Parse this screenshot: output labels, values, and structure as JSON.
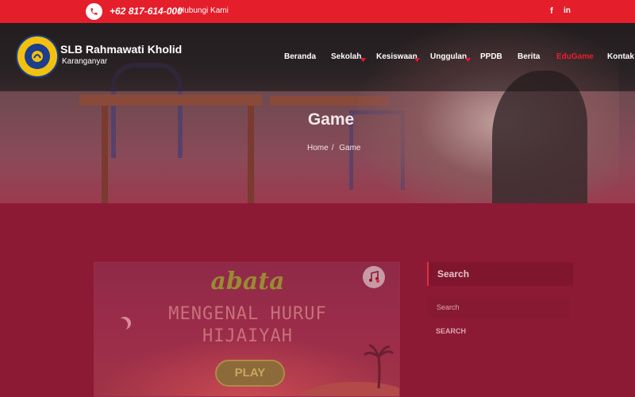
{
  "topbar": {
    "phone": "+62 817-614-000",
    "contact_label": "Hubungi Kami",
    "social": {
      "facebook": "f",
      "linkedin": "in"
    }
  },
  "header": {
    "site_title": "SLB Rahmawati Kholid",
    "site_subtitle": "Karanganyar",
    "nav": [
      {
        "label": "Beranda",
        "dropdown": false,
        "active": false
      },
      {
        "label": "Sekolah",
        "dropdown": true,
        "active": false
      },
      {
        "label": "Kesiswaan",
        "dropdown": true,
        "active": false
      },
      {
        "label": "Unggulan",
        "dropdown": true,
        "active": false
      },
      {
        "label": "PPDB",
        "dropdown": false,
        "active": false
      },
      {
        "label": "Berita",
        "dropdown": false,
        "active": false
      },
      {
        "label": "EduGame",
        "dropdown": false,
        "active": true
      },
      {
        "label": "Kontak",
        "dropdown": false,
        "active": false
      }
    ]
  },
  "hero": {
    "title": "Game",
    "breadcrumb": [
      "Home",
      "Game"
    ]
  },
  "game": {
    "logo_text": "abata",
    "title_line1": "MENGENAL HURUF",
    "title_line2": "HIJAIYAH",
    "play_label": "PLAY",
    "music_icon": "music-icon"
  },
  "sidebar": {
    "search_title": "Search",
    "search_placeholder": "Search",
    "search_button": "SEARCH"
  },
  "colors": {
    "topbar": "#e41e2b",
    "accent": "#ee1c2c",
    "overlay": "#8d1a35"
  }
}
